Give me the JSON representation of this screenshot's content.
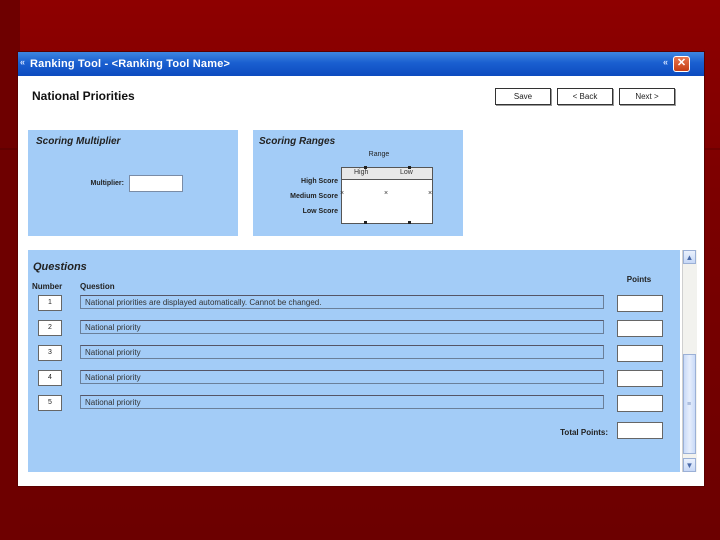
{
  "window": {
    "title": "Ranking Tool - <Ranking Tool Name>",
    "left_glyph": "«",
    "right_glyph": "«",
    "close_label": "✕"
  },
  "header": {
    "page_title": "National Priorities",
    "save_label": "Save",
    "back_label": "< Back",
    "next_label": "Next >"
  },
  "scoring_multiplier": {
    "title": "Scoring Multiplier",
    "multiplier_label": "Multiplier:",
    "multiplier_value": ""
  },
  "scoring_ranges": {
    "title": "Scoring Ranges",
    "range_label": "Range",
    "high_label": "High",
    "low_label": "Low",
    "rows": [
      "High Score",
      "Medium Score",
      "Low Score"
    ],
    "x_mark": "×"
  },
  "questions": {
    "title": "Questions",
    "number_header": "Number",
    "question_header": "Question",
    "points_header": "Points",
    "rows": [
      {
        "number": "1",
        "text": "National priorities are displayed automatically. Cannot be changed.",
        "points": ""
      },
      {
        "number": "2",
        "text": "National priority",
        "points": ""
      },
      {
        "number": "3",
        "text": "National priority",
        "points": ""
      },
      {
        "number": "4",
        "text": "National priority",
        "points": ""
      },
      {
        "number": "5",
        "text": "National priority",
        "points": ""
      }
    ],
    "total_label": "Total Points:",
    "total_value": ""
  },
  "scrollbar": {
    "up_label": "▲",
    "down_label": "▼",
    "grip_label": "≡"
  },
  "colors": {
    "panel": "#a3ccf7",
    "titlebar": "#1a5fd0",
    "background": "#7a0000"
  }
}
